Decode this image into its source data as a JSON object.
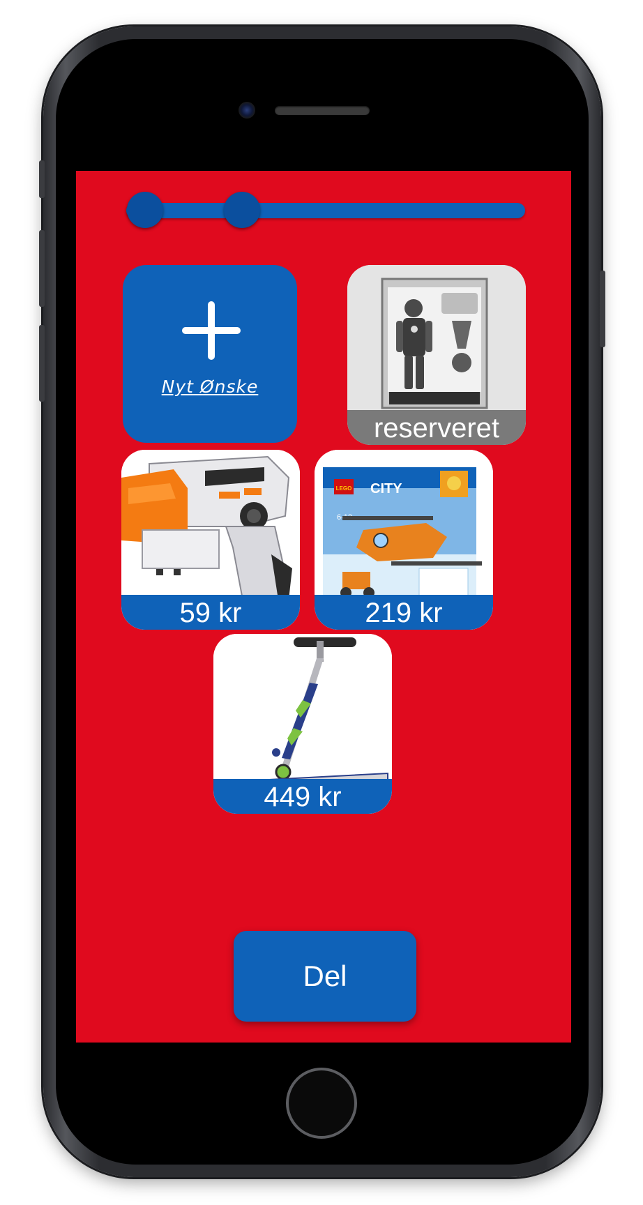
{
  "slider": {
    "knob_values": [
      0.08,
      0.35
    ]
  },
  "wishes": {
    "add_label": "Nyt Ønske",
    "items": [
      {
        "label": "reserveret",
        "product": "Avengers action figure",
        "status": "reserved"
      },
      {
        "label": "59 kr",
        "product": "toy water blaster",
        "status": "available"
      },
      {
        "label": "219 kr",
        "product": "LEGO City helicopter",
        "status": "available"
      },
      {
        "label": "449 kr",
        "product": "kick scooter",
        "status": "available"
      }
    ]
  },
  "share_button": {
    "label": "Del"
  },
  "colors": {
    "background": "#e00a1e",
    "primary": "#0f62b8",
    "reserved_bar": "#7a7a7a"
  },
  "icons": {
    "add": "plus-icon"
  }
}
